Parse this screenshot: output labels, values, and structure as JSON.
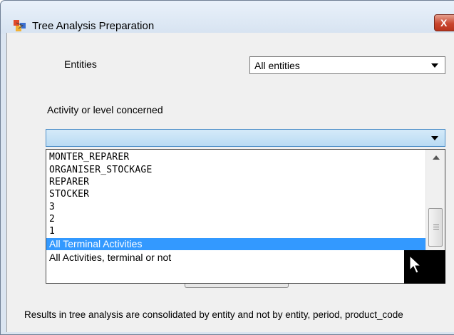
{
  "window": {
    "title": "Tree Analysis Preparation",
    "close_label": "X"
  },
  "entities": {
    "label": "Entities",
    "selected": "All entities"
  },
  "activity": {
    "label": "Activity or level concerned",
    "selected": "",
    "options": [
      "MONTER_REPARER",
      "ORGANISER_STOCKAGE",
      "REPARER",
      "STOCKER",
      "3",
      "2",
      "1",
      "All Terminal Activities",
      "All Activities, terminal or not"
    ],
    "highlighted_option": "All Terminal Activities"
  },
  "footer": {
    "note": "Results in tree analysis are consolidated by entity and not by entity, period, product_code"
  },
  "colors": {
    "selection": "#3399ff",
    "focused_combo": "#b9dbf3",
    "close_button": "#c9462f"
  },
  "icons": [
    "app-icon",
    "chevron-down-icon",
    "scroll-up-icon",
    "mouse-cursor-icon"
  ]
}
